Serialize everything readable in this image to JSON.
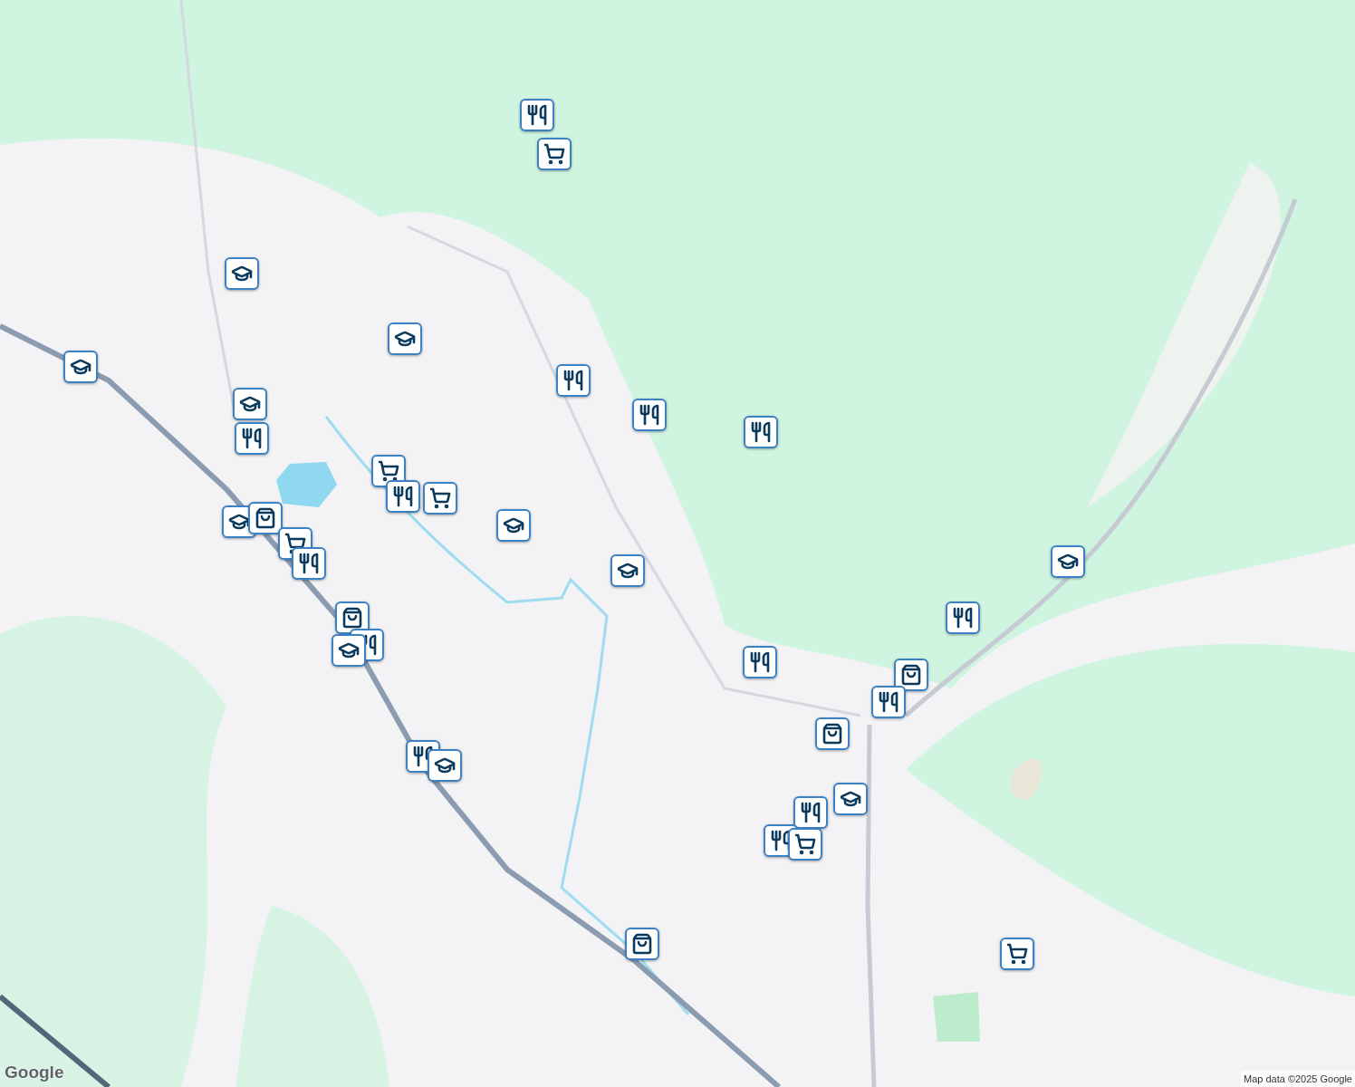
{
  "markers": [
    {
      "kind": "restaurant"
    },
    {
      "kind": "grocery"
    },
    {
      "kind": "school"
    },
    {
      "kind": "school"
    },
    {
      "kind": "school"
    },
    {
      "kind": "restaurant"
    },
    {
      "kind": "restaurant"
    },
    {
      "kind": "restaurant"
    },
    {
      "kind": "school"
    },
    {
      "kind": "restaurant"
    },
    {
      "kind": "grocery"
    },
    {
      "kind": "restaurant"
    },
    {
      "kind": "grocery"
    },
    {
      "kind": "school"
    },
    {
      "kind": "school"
    },
    {
      "kind": "shopping"
    },
    {
      "kind": "grocery"
    },
    {
      "kind": "restaurant"
    },
    {
      "kind": "school"
    },
    {
      "kind": "shopping"
    },
    {
      "kind": "restaurant"
    },
    {
      "kind": "school"
    },
    {
      "kind": "school"
    },
    {
      "kind": "restaurant"
    },
    {
      "kind": "restaurant"
    },
    {
      "kind": "shopping"
    },
    {
      "kind": "restaurant"
    },
    {
      "kind": "shopping"
    },
    {
      "kind": "restaurant"
    },
    {
      "kind": "school"
    },
    {
      "kind": "school"
    },
    {
      "kind": "restaurant"
    },
    {
      "kind": "restaurant"
    },
    {
      "kind": "grocery"
    },
    {
      "kind": "shopping"
    },
    {
      "kind": "grocery"
    }
  ],
  "logo": "Google",
  "attribution": "Map data ©2025 Google"
}
